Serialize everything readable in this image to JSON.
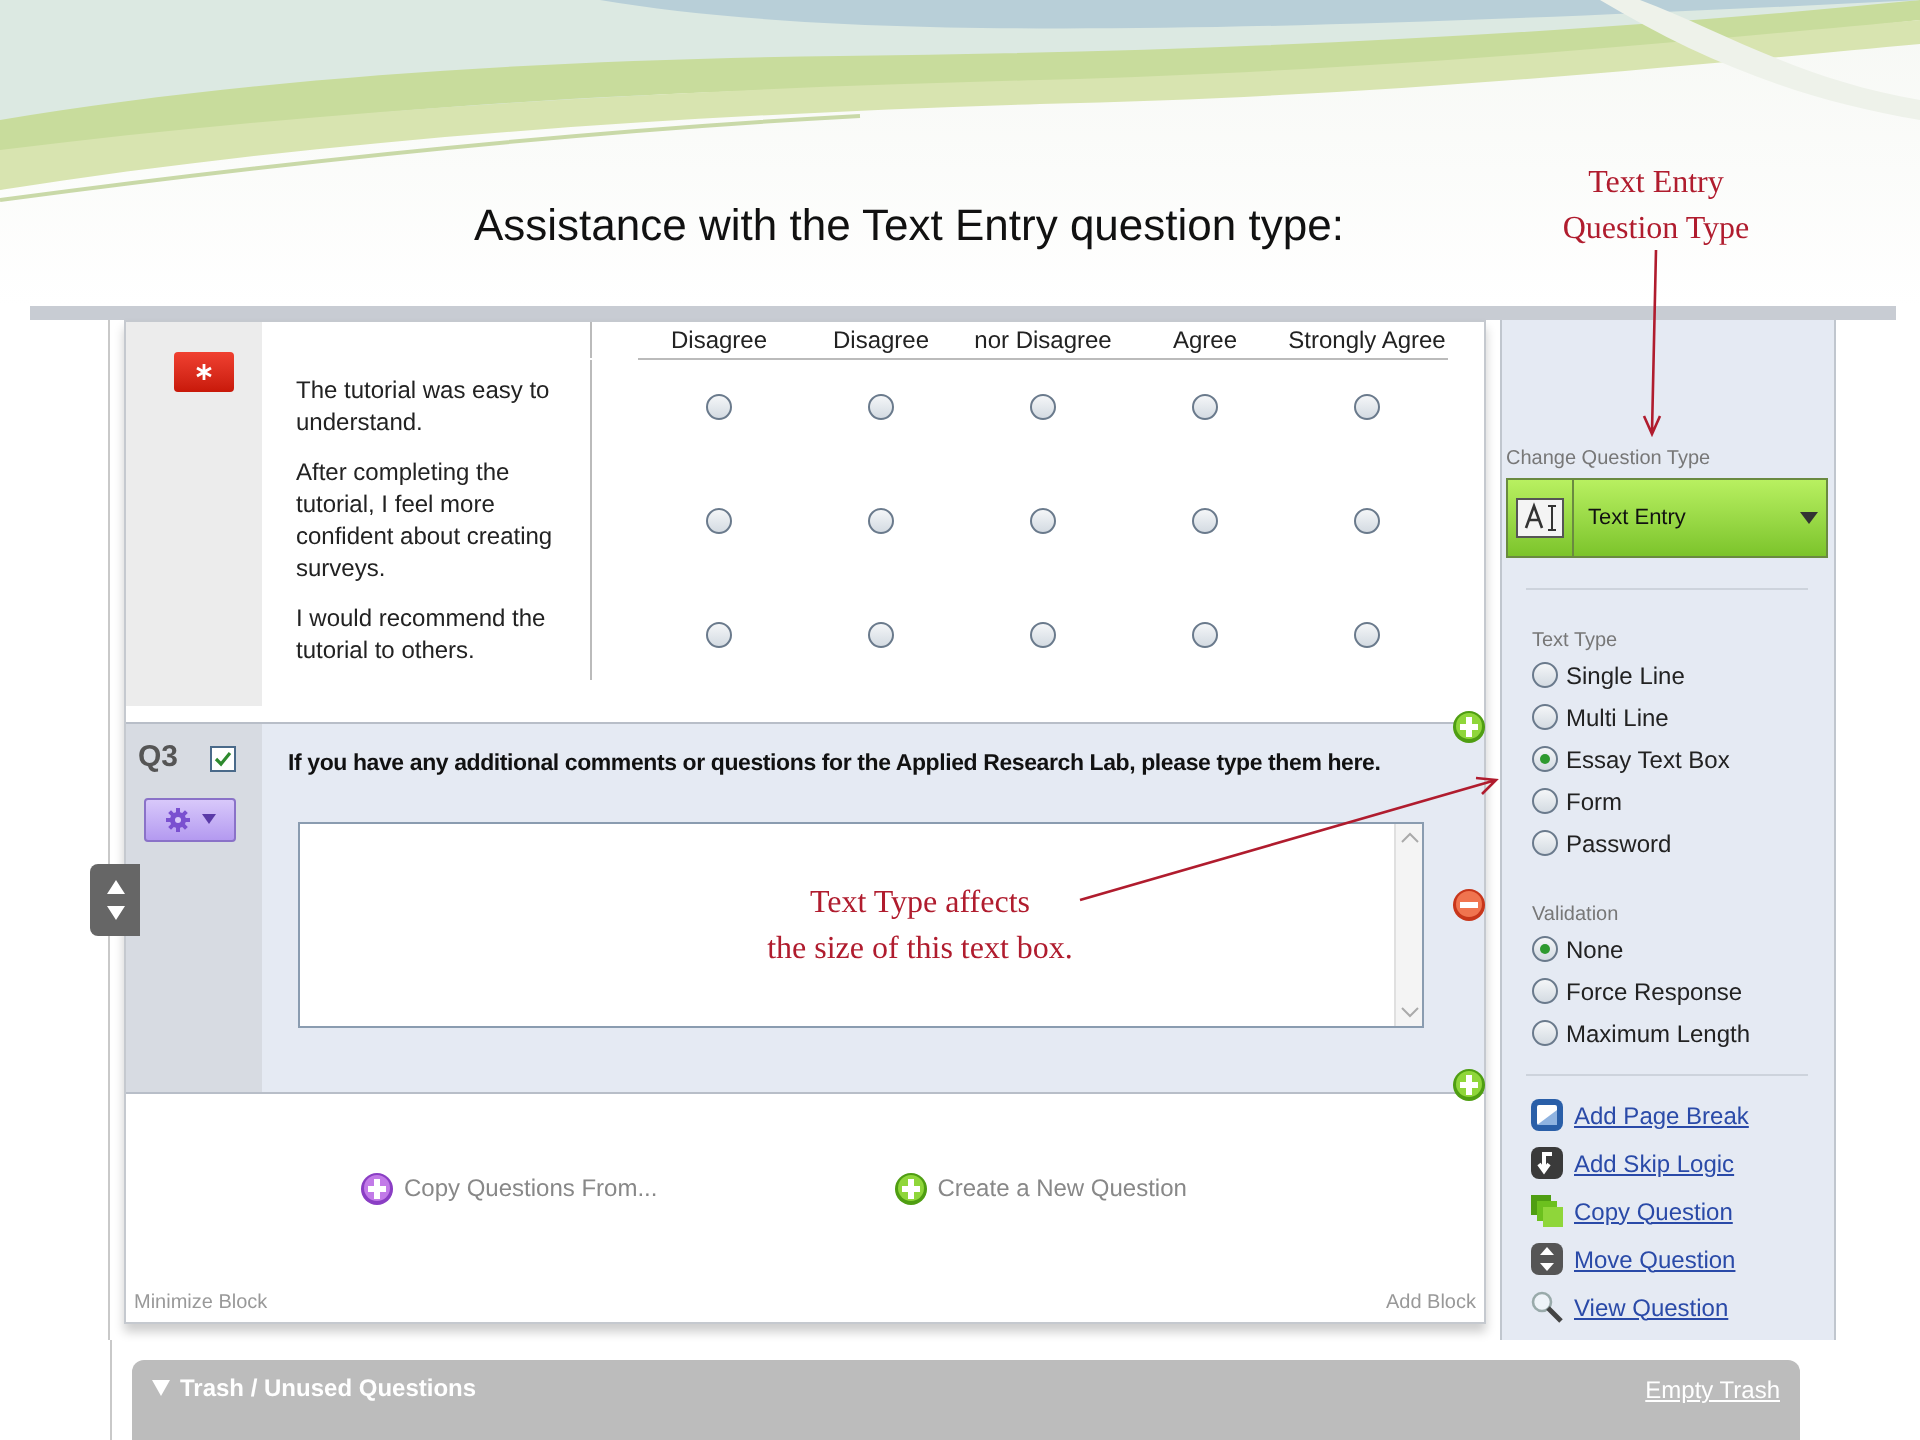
{
  "slide": {
    "title": "Assistance with the Text Entry question type:"
  },
  "annotations": [
    {
      "lines": [
        "Text Entry",
        "Question Type"
      ]
    },
    {
      "lines": [
        "Text Type affects",
        "the size of this text box."
      ]
    }
  ],
  "matrix": {
    "columns": [
      "Disagree",
      "Disagree",
      "nor Disagree",
      "Agree",
      "Strongly Agree"
    ],
    "rows": [
      {
        "statement": "The tutorial was easy to understand.",
        "choices": [
          {
            "selected": false
          },
          {
            "selected": false
          },
          {
            "selected": false
          },
          {
            "selected": false
          },
          {
            "selected": false
          }
        ]
      },
      {
        "statement": "After completing the tutorial, I feel more confident about creating surveys.",
        "choices": [
          {
            "selected": false
          },
          {
            "selected": false
          },
          {
            "selected": false
          },
          {
            "selected": false
          },
          {
            "selected": false
          }
        ]
      },
      {
        "statement": "I would recommend the tutorial to others.",
        "choices": [
          {
            "selected": false
          },
          {
            "selected": false
          },
          {
            "selected": false
          },
          {
            "selected": false
          },
          {
            "selected": false
          }
        ]
      }
    ]
  },
  "question": {
    "number": "Q3",
    "checked": true,
    "text": "If you have any additional comments or questions for the Applied Research Lab, please type them here."
  },
  "block_actions": [
    "Copy Questions From...",
    "Create a New Question"
  ],
  "block_footer": {
    "left": "Minimize Block",
    "right": "Add Block"
  },
  "trash": {
    "title": "Trash / Unused Questions",
    "action": "Empty Trash"
  },
  "panel": {
    "change_label": "Change Question Type",
    "question_type": "Text Entry",
    "groups": [
      {
        "label": "Text Type",
        "options": [
          {
            "label": "Single Line",
            "selected": false
          },
          {
            "label": "Multi Line",
            "selected": false
          },
          {
            "label": "Essay Text Box",
            "selected": true
          },
          {
            "label": "Form",
            "selected": false
          },
          {
            "label": "Password",
            "selected": false
          }
        ]
      },
      {
        "label": "Validation",
        "options": [
          {
            "label": "None",
            "selected": true
          },
          {
            "label": "Force Response",
            "selected": false
          },
          {
            "label": "Maximum Length",
            "selected": false
          }
        ]
      }
    ],
    "links": [
      {
        "label": "Add Page Break",
        "kind": "page-break"
      },
      {
        "label": "Add Skip Logic",
        "kind": "skip-logic"
      },
      {
        "label": "Copy Question",
        "kind": "copy"
      },
      {
        "label": "Move Question",
        "kind": "move"
      },
      {
        "label": "View Question",
        "kind": "view"
      }
    ]
  }
}
